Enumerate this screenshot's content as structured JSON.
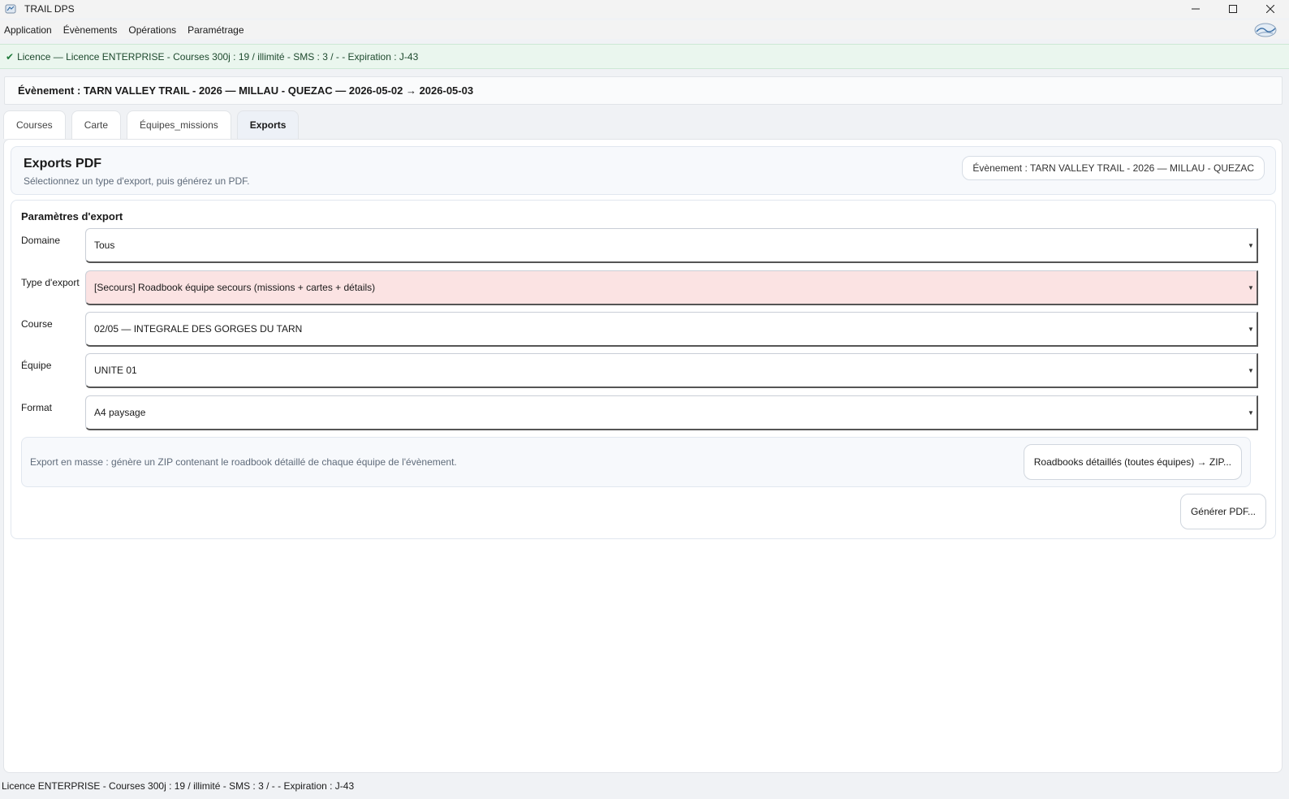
{
  "window": {
    "title": "TRAIL DPS"
  },
  "menu": {
    "items": [
      "Application",
      "Évènements",
      "Opérations",
      "Paramétrage"
    ]
  },
  "license_banner": {
    "text": "Licence — Licence ENTERPRISE - Courses 300j : 19 / illimité - SMS : 3 / - - Expiration : J-43"
  },
  "event_header": {
    "text": "Évènement : TARN VALLEY TRAIL - 2026 — MILLAU - QUEZAC — 2026-05-02 → 2026-05-03"
  },
  "tabs": [
    {
      "label": "Courses",
      "active": false
    },
    {
      "label": "Carte",
      "active": false
    },
    {
      "label": "Équipes_missions",
      "active": false
    },
    {
      "label": "Exports",
      "active": true
    }
  ],
  "exports": {
    "title": "Exports PDF",
    "subtitle": "Sélectionnez un type d'export, puis générez un PDF.",
    "event_pill": "Évènement : TARN VALLEY TRAIL - 2026 — MILLAU - QUEZAC"
  },
  "params": {
    "title": "Paramètres d'export",
    "fields": [
      {
        "label": "Domaine",
        "value": "Tous"
      },
      {
        "label": "Type d'export",
        "value": "[Secours] Roadbook équipe secours (missions + cartes + détails)"
      },
      {
        "label": "Course",
        "value": "02/05 — INTEGRALE DES GORGES DU TARN"
      },
      {
        "label": "Équipe",
        "value": "UNITE 01"
      },
      {
        "label": "Format",
        "value": "A4 paysage"
      }
    ],
    "bulk_text": "Export en masse : génère un ZIP contenant le roadbook détaillé de chaque équipe de l'évènement.",
    "bulk_button": "Roadbooks détaillés (toutes équipes) → ZIP...",
    "generate_button": "Générer PDF..."
  },
  "status_bar": {
    "text": "Licence ENTERPRISE - Courses 300j : 19 / illimité - SMS : 3 / - - Expiration : J-43"
  },
  "colors": {
    "banner_bg": "#eaf6ee",
    "highlight_field": "#fbe3e3",
    "active_tab": "#edf1f7"
  }
}
